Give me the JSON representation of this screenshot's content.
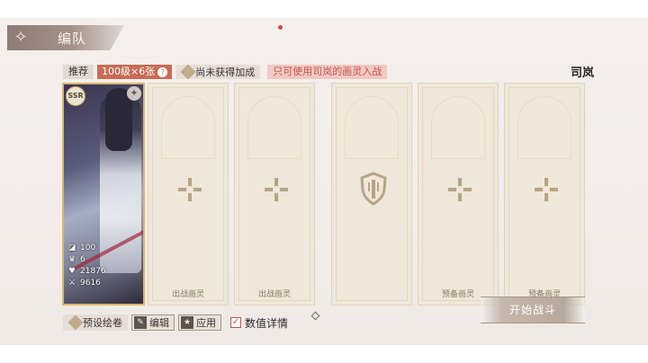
{
  "header": {
    "title": "编队",
    "title_icon": "butterfly-icon"
  },
  "requirements": {
    "label": "推荐",
    "level_req": "100级×6张",
    "bonus_text": "尚未获得加成",
    "restriction": "只可使用司岚的画灵入战"
  },
  "team_name": "司岚",
  "card": {
    "rarity": "SSR",
    "level": "100",
    "stars": "6",
    "hp": "21876",
    "attack": "9616"
  },
  "slots": {
    "battle_label": "出战画灵",
    "reserve_label": "预备画灵"
  },
  "footer": {
    "preset_label": "预设绘卷",
    "edit_label": "编辑",
    "apply_label": "应用",
    "stats_detail_label": "数值详情",
    "stats_detail_checked": true,
    "start_label": "开始战斗"
  },
  "colors": {
    "accent_red": "#c86b56",
    "gold": "#d9b66a",
    "slot_bg": "#efe7d9"
  }
}
